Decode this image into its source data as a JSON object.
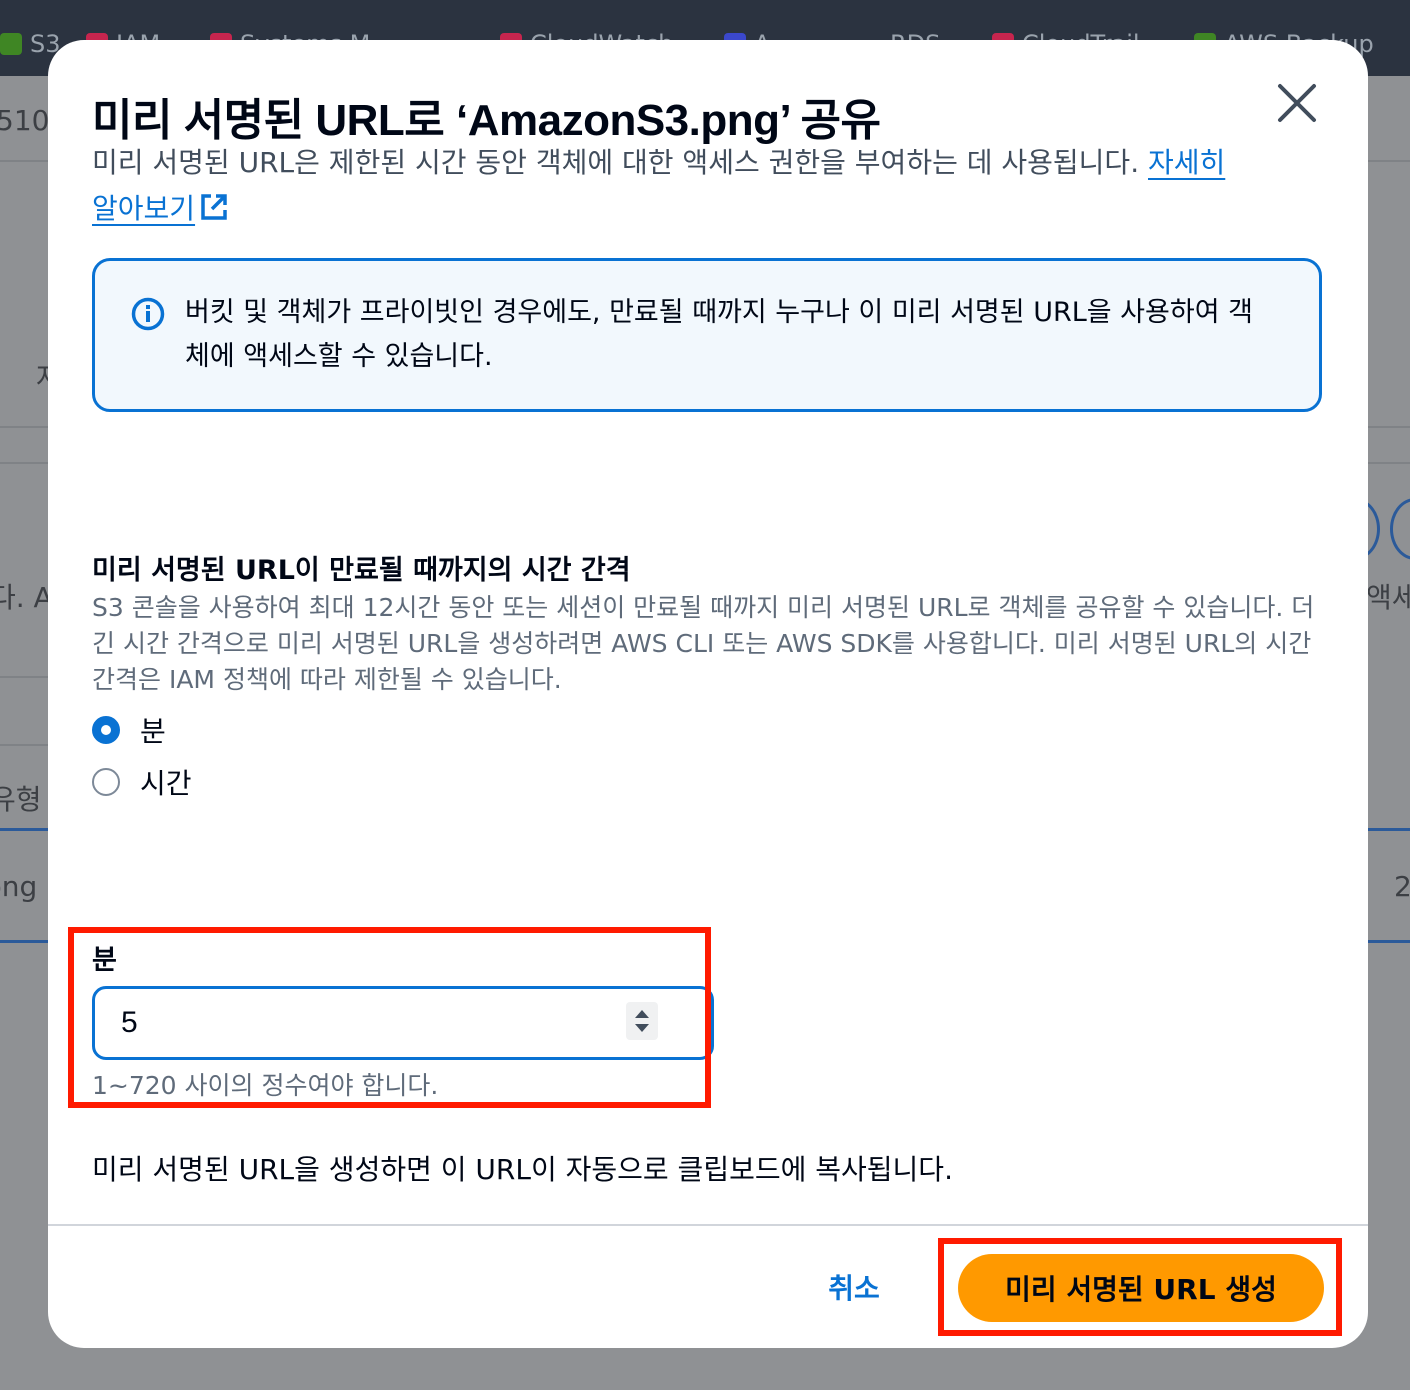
{
  "background": {
    "favorites": [
      {
        "label": "S3",
        "color": "#3f8624"
      },
      {
        "label": "IAM",
        "color": "#c7254e"
      },
      {
        "label": "Systems M...",
        "color": "#c7254e"
      },
      {
        "label": "CloudWatch",
        "color": "#c7254e"
      },
      {
        "label": "A...",
        "color": "#3b48cc"
      },
      {
        "label": "RDS",
        "color": "#3b48cc"
      },
      {
        "label": "CloudTrail",
        "color": "#c7254e"
      },
      {
        "label": "AWS Backup",
        "color": "#3f8624"
      }
    ],
    "fragments": [
      "510",
      "자",
      "다. A",
      "유형",
      "png",
      "액세",
      "2"
    ]
  },
  "modal": {
    "title": "미리 서명된 URL로 ‘AmazonS3.png’ 공유",
    "description": "미리 서명된 URL은 제한된 시간 동안 객체에 대한 액세스 권한을 부여하는 데 사용됩니다. ",
    "learn_more": "자세히 알아보기",
    "alert": "버킷 및 객체가 프라이빗인 경우에도, 만료될 때까지 누구나 이 미리 서명된 URL을 사용하여 객체에 액세스할 수 있습니다.",
    "interval_label": "미리 서명된 URL이 만료될 때까지의 시간 간격",
    "interval_desc": "S3 콘솔을 사용하여 최대 12시간 동안 또는 세션이 만료될 때까지 미리 서명된 URL로 객체를 공유할 수 있습니다. 더 긴 시간 간격으로 미리 서명된 URL을 생성하려면 AWS CLI 또는 AWS SDK를 사용합니다. 미리 서명된 URL의 시간 간격은 IAM 정책에 따라 제한될 수 있습니다.",
    "radio_options": [
      {
        "label": "분",
        "selected": true
      },
      {
        "label": "시간",
        "selected": false
      }
    ],
    "field_label": "분",
    "field_value": "5",
    "field_constraint": "1~720 사이의 정수여야 합니다.",
    "clipboard_note": "미리 서명된 URL을 생성하면 이 URL이 자동으로 클립보드에 복사됩니다.",
    "cancel_label": "취소",
    "submit_label": "미리 서명된 URL 생성"
  },
  "colors": {
    "accent": "#0972d3",
    "primary_button": "#ff9900",
    "highlight": "#ff1a00"
  }
}
